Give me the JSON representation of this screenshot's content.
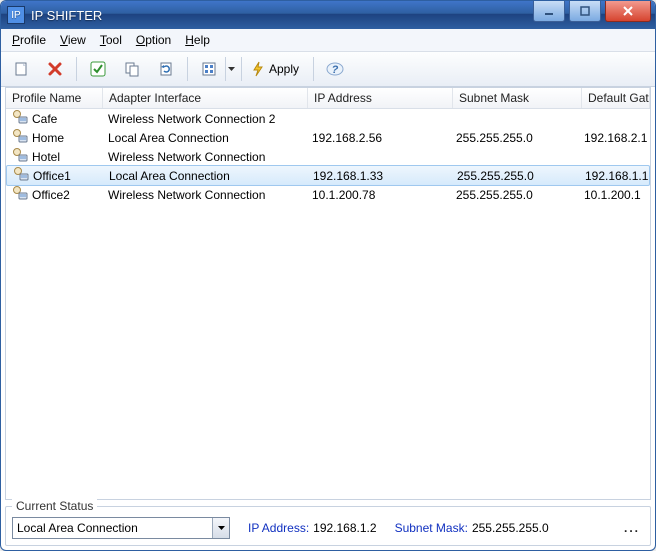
{
  "window": {
    "title": "IP SHIFTER"
  },
  "menu": {
    "profile": "Profile",
    "view": "View",
    "tool": "Tool",
    "option": "Option",
    "help": "Help"
  },
  "toolbar": {
    "apply_label": "Apply"
  },
  "columns": {
    "name": "Profile Name",
    "adapter": "Adapter Interface",
    "ip": "IP Address",
    "mask": "Subnet Mask",
    "gw": "Default Gateway"
  },
  "profiles": [
    {
      "name": "Cafe",
      "adapter": "Wireless Network Connection 2",
      "ip": "",
      "mask": "",
      "gw": "",
      "selected": false
    },
    {
      "name": "Home",
      "adapter": "Local Area Connection",
      "ip": "192.168.2.56",
      "mask": "255.255.255.0",
      "gw": "192.168.2.1",
      "selected": false
    },
    {
      "name": "Hotel",
      "adapter": "Wireless Network Connection",
      "ip": "",
      "mask": "",
      "gw": "",
      "selected": false
    },
    {
      "name": "Office1",
      "adapter": "Local Area Connection",
      "ip": "192.168.1.33",
      "mask": "255.255.255.0",
      "gw": "192.168.1.1",
      "selected": true
    },
    {
      "name": "Office2",
      "adapter": "Wireless Network Connection",
      "ip": "10.1.200.78",
      "mask": "255.255.255.0",
      "gw": "10.1.200.1",
      "selected": false
    }
  ],
  "status": {
    "legend": "Current Status",
    "adapter_selected": "Local Area Connection",
    "ip_label": "IP Address:",
    "ip_value": "192.168.1.2",
    "mask_label": "Subnet Mask:",
    "mask_value": "255.255.255.0",
    "more": "..."
  }
}
